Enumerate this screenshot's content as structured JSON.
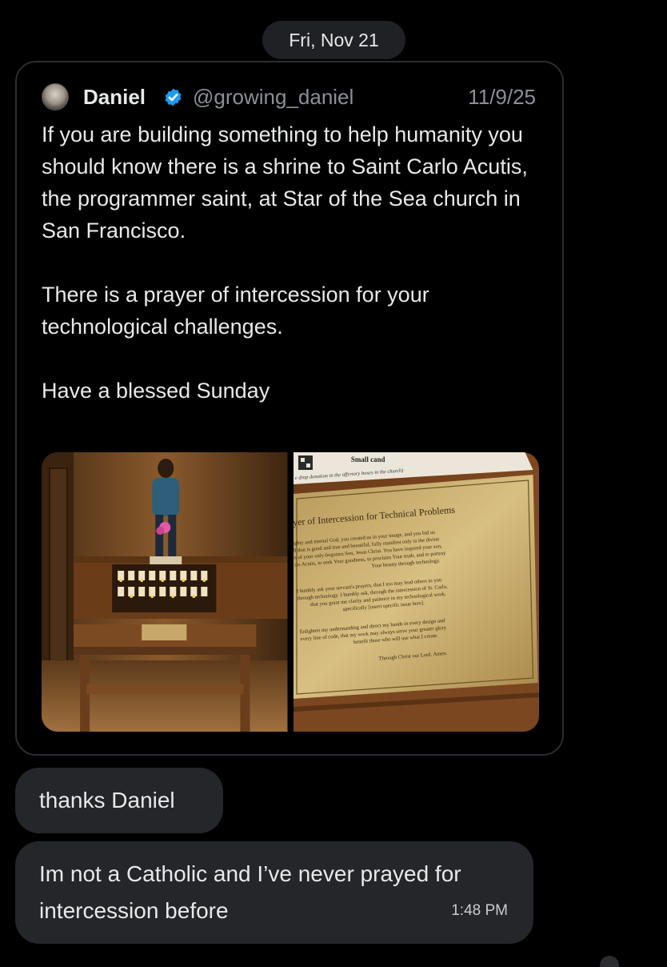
{
  "date_separator": "Fri, Nov 21",
  "tweet": {
    "author_name": "Daniel",
    "handle": "@growing_daniel",
    "date": "11/9/25",
    "verified_icon": "verified-badge-icon",
    "avatar_icon": "avatar",
    "paragraphs": [
      "If you are building something to help humanity you should know there is a shrine to Saint Carlo Acutis, the programmer saint, at Star of the Sea church in San Francisco.",
      "There is a prayer of intercession for your technological challenges.",
      "Have a blessed Sunday"
    ],
    "plaque": {
      "header_label": "Small cand",
      "donation_note": "e drop donation in the offertory boxes in the church)",
      "title": "yer of Intercession for Technical Problems",
      "paragraph_1": [
        "ighty and eternal God, you created us in your image, and you bid us",
        "ll that is good and true and beautiful, fully manifest only in the divine",
        "n of your only-begotten Son, Jesus Christ. You have inspired your son,",
        "rlo Acutis, to seek Your goodness, to proclaim Your truth, and to portray",
        "Your beauty through technology."
      ],
      "paragraph_2": [
        "I humbly ask your servant's prayers, that I too may lead others to you",
        "through technology. I humbly ask, through the intercession of St. Carlo,",
        "that you grant me clarity and patience in my technological work,",
        "specifically [insert specific issue here]."
      ],
      "paragraph_3": [
        "Enlighten my understanding and direct my hands in every design and",
        "every line of code, that my work may always serve your greater glory",
        "benefit those who will use what I create."
      ],
      "closing": "Through Christ our Lord. Amen."
    }
  },
  "messages": [
    {
      "text": "thanks Daniel"
    },
    {
      "text": "Im not a Catholic and I’ve never prayed for intercession before",
      "time": "1:48 PM"
    }
  ],
  "colors": {
    "background": "#000000",
    "bubble": "#24262a",
    "verified": "#1d9bf0",
    "muted": "#8b9096"
  }
}
